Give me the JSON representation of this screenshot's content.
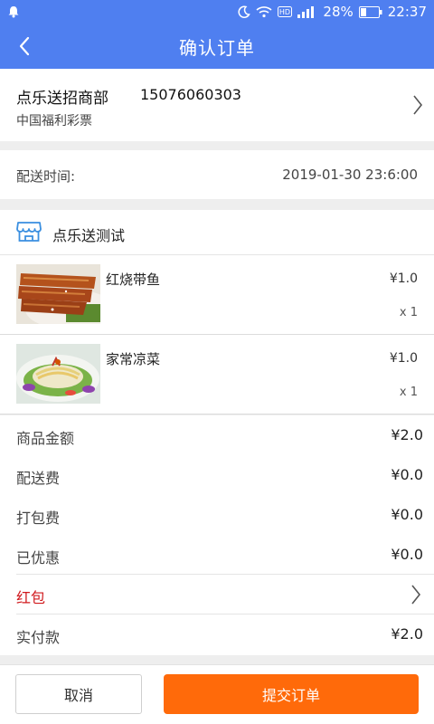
{
  "status_bar": {
    "battery": "28%",
    "time": "22:37",
    "icons": [
      "notification-icon",
      "moon-icon",
      "wifi-icon",
      "hd-icon",
      "signal-icon",
      "battery-icon"
    ]
  },
  "nav": {
    "title": "确认订单",
    "back_icon": "back-arrow-icon"
  },
  "merchant": {
    "name": "点乐送招商部",
    "phone": "15076060303",
    "subtitle": "中国福利彩票"
  },
  "delivery": {
    "label": "配送时间:",
    "value": "2019-01-30 23:6:00"
  },
  "shop": {
    "name": "点乐送测试",
    "icon": "shop-icon"
  },
  "items": [
    {
      "name": "红烧带鱼",
      "price": "¥1.0",
      "qty": "x 1"
    },
    {
      "name": "家常凉菜",
      "price": "¥1.0",
      "qty": "x 1"
    }
  ],
  "summary": {
    "goods_amount": {
      "label": "商品金额",
      "value": "¥2.0"
    },
    "delivery_fee": {
      "label": "配送费",
      "value": "¥0.0"
    },
    "packing_fee": {
      "label": "打包费",
      "value": "¥0.0"
    },
    "discount": {
      "label": "已优惠",
      "value": "¥0.0"
    },
    "red_packet": {
      "label": "红包"
    },
    "paid": {
      "label": "实付款",
      "value": "¥2.0"
    }
  },
  "actions": {
    "cancel": "取消",
    "submit": "提交订单"
  },
  "colors": {
    "primary": "#4f7ff0",
    "accent": "#ff6a0a",
    "red": "#d0191d"
  }
}
